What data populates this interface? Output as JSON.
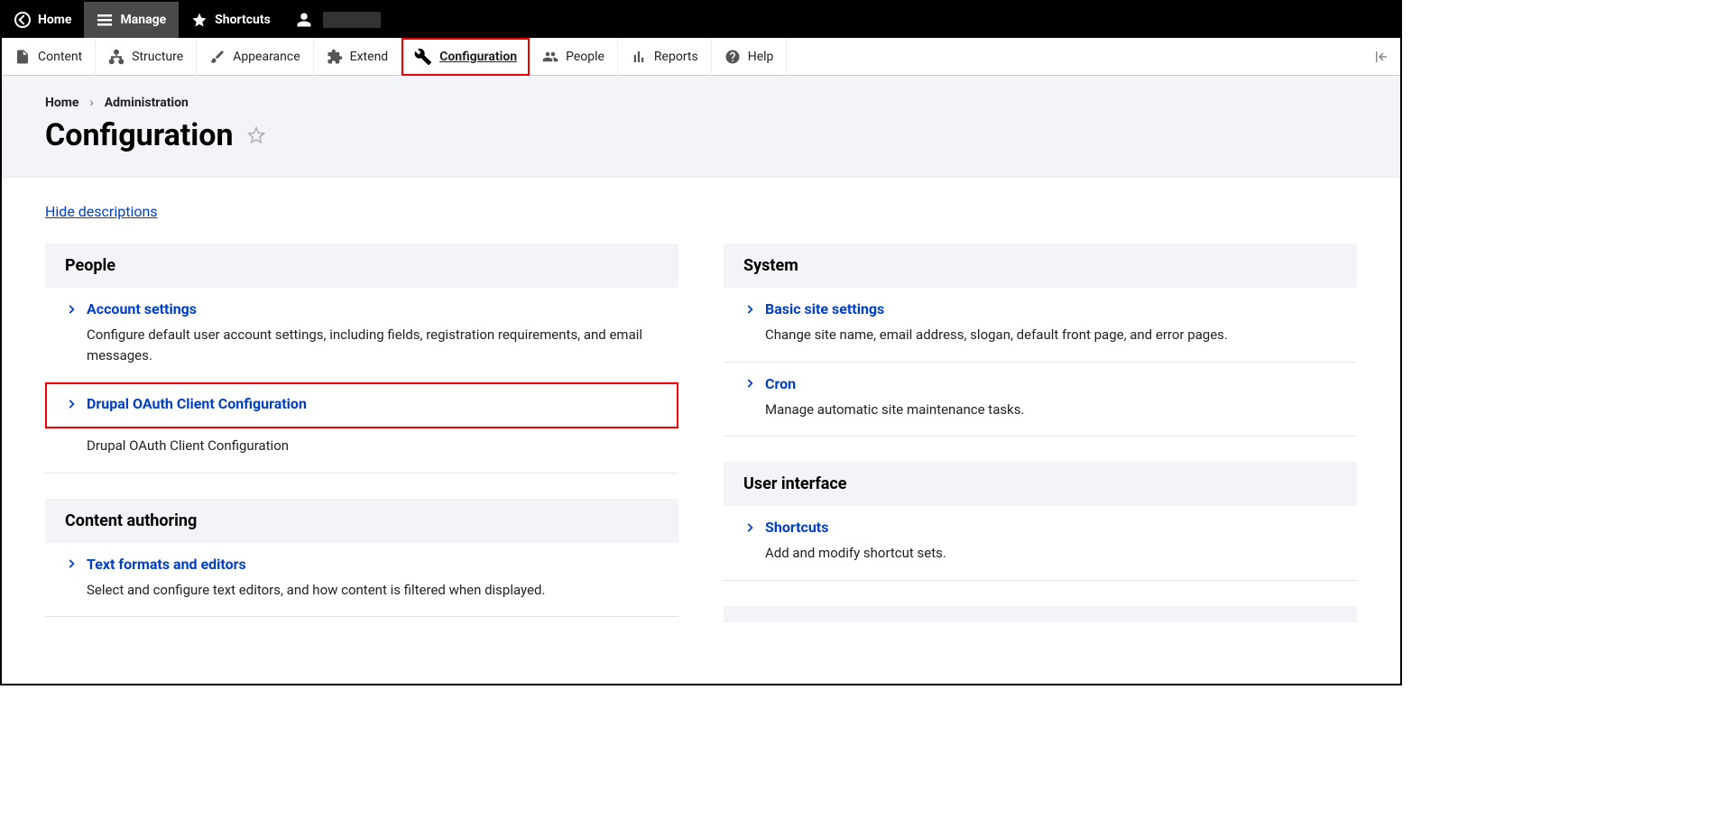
{
  "toolbar": {
    "home": "Home",
    "manage": "Manage",
    "shortcuts": "Shortcuts"
  },
  "admin_menu": {
    "content": "Content",
    "structure": "Structure",
    "appearance": "Appearance",
    "extend": "Extend",
    "configuration": "Configuration",
    "people": "People",
    "reports": "Reports",
    "help": "Help"
  },
  "breadcrumb": {
    "home": "Home",
    "admin": "Administration"
  },
  "page_title": "Configuration",
  "hide_descriptions": "Hide descriptions",
  "sections": {
    "people": {
      "title": "People",
      "items": [
        {
          "title": "Account settings",
          "desc": "Configure default user account settings, including fields, registration requirements, and email messages."
        },
        {
          "title": "Drupal OAuth Client Configuration",
          "desc": "Drupal OAuth Client Configuration"
        }
      ]
    },
    "content_authoring": {
      "title": "Content authoring",
      "items": [
        {
          "title": "Text formats and editors",
          "desc": "Select and configure text editors, and how content is filtered when displayed."
        }
      ]
    },
    "system": {
      "title": "System",
      "items": [
        {
          "title": "Basic site settings",
          "desc": "Change site name, email address, slogan, default front page, and error pages."
        },
        {
          "title": "Cron",
          "desc": "Manage automatic site maintenance tasks."
        }
      ]
    },
    "user_interface": {
      "title": "User interface",
      "items": [
        {
          "title": "Shortcuts",
          "desc": "Add and modify shortcut sets."
        }
      ]
    }
  }
}
